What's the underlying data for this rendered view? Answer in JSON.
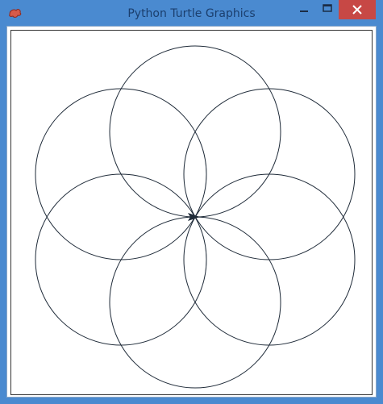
{
  "window": {
    "title": "Python Turtle Graphics",
    "app_icon": "python-turtle-icon",
    "titlebar_color": "#4a8ad0",
    "controls": {
      "minimize_icon": "minimize-icon",
      "maximize_icon": "maximize-icon",
      "close_icon": "close-icon",
      "close_color": "#c74845"
    }
  },
  "canvas": {
    "drawing": "six overlapping circles around a common center",
    "circle_count": 6,
    "stroke_color": "#1e2a38",
    "turtle_icon": "arrow-cursor-icon"
  }
}
